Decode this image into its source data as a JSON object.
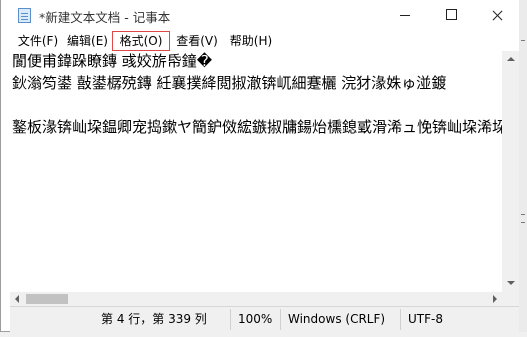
{
  "window": {
    "title": "*新建文本文档 - 记事本"
  },
  "menu": {
    "file": "文件(F)",
    "edit": "编辑(E)",
    "format": "格式(O)",
    "view": "查看(V)",
    "help": "帮助(H)"
  },
  "editor": {
    "lines": [
      "閬便甫鍏跺瞭鏄   彧姣旂帋鐘�",
      "鈥滃笉鍙   敼鍙樼殑鏄   紝襄撲絳閲掓澈锛屼細蹇欐   浣犲湪姝ゅ湴鍍",
      "",
      "鐜板湪锛屾垜鎾卿宠捣鏉ヤ簡鈩傚綋鏃掓牗鍚炲櫄鎴戜滑浠ュ悗锛屾垜浠垜"
    ]
  },
  "status": {
    "position": "第 4 行，第 339 列",
    "zoom": "100%",
    "line_ending": "Windows (CRLF)",
    "encoding": "UTF-8"
  },
  "colors": {
    "highlight_border": "#e04848",
    "status_bg": "#f0f0f0"
  },
  "icons": {
    "app": "notepad-icon",
    "minimize": "minimize-icon",
    "maximize": "maximize-icon",
    "close": "close-icon"
  }
}
